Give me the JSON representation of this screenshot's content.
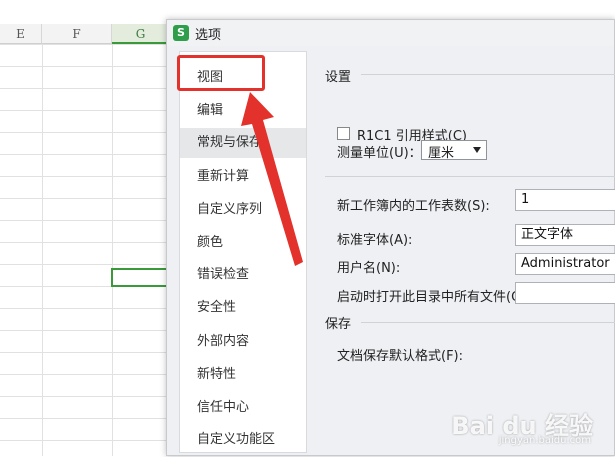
{
  "sheet": {
    "columns": [
      {
        "label": "E",
        "active": false
      },
      {
        "label": "F",
        "active": false
      },
      {
        "label": "G",
        "active": true
      }
    ]
  },
  "dialog": {
    "title": "选项",
    "app_icon": "S",
    "nav": [
      {
        "label": "视图",
        "selected": false
      },
      {
        "label": "编辑",
        "selected": false
      },
      {
        "label": "常规与保存",
        "selected": true
      },
      {
        "label": "重新计算",
        "selected": false
      },
      {
        "label": "自定义序列",
        "selected": false
      },
      {
        "label": "颜色",
        "selected": false
      },
      {
        "label": "错误检查",
        "selected": false
      },
      {
        "label": "安全性",
        "selected": false
      },
      {
        "label": "外部内容",
        "selected": false
      },
      {
        "label": "新特性",
        "selected": false
      },
      {
        "label": "信任中心",
        "selected": false
      },
      {
        "label": "自定义功能区",
        "selected": false
      }
    ],
    "settings": {
      "group_title": "设置",
      "r1c1_label": "R1C1 引用样式(C)",
      "r1c1_checked": false,
      "unit_label": "测量单位(U)：",
      "unit_value": "厘米",
      "sheets_label": "新工作簿内的工作表数(S):",
      "sheets_value": "1",
      "font_label": "标准字体(A):",
      "font_value": "正文字体",
      "username_label": "用户名(N):",
      "username_value": "Administrator",
      "startup_label": "启动时打开此目录中所有文件(O):",
      "startup_value": ""
    },
    "save": {
      "group_title": "保存",
      "format_label": "文档保存默认格式(F):"
    }
  },
  "annotation": {
    "color": "#e2322b"
  },
  "watermark": {
    "main": "Bai du 经验",
    "sub": "jingyan.baidu.com"
  }
}
